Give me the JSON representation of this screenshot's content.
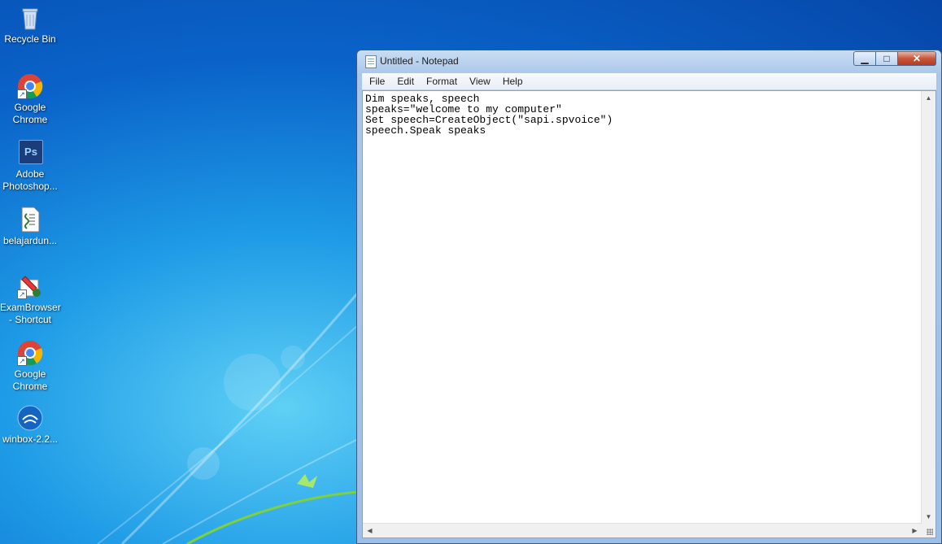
{
  "desktop": {
    "icons": [
      {
        "label": "Recycle Bin",
        "icon": "recycle-bin-icon"
      },
      {
        "label": "Google Chrome",
        "icon": "chrome-icon"
      },
      {
        "label": "Adobe Photoshop...",
        "icon": "photoshop-icon",
        "badge": "Ps"
      },
      {
        "label": "belajardun...",
        "icon": "script-file-icon"
      },
      {
        "label": "ExamBrowser - Shortcut",
        "icon": "exam-browser-icon"
      },
      {
        "label": "Google Chrome",
        "icon": "chrome-icon"
      },
      {
        "label": "winbox-2.2...",
        "icon": "winbox-icon"
      }
    ]
  },
  "window": {
    "title": "Untitled - Notepad",
    "controls": {
      "minimize": "▁",
      "maximize": "□",
      "close": "✕"
    },
    "menu": [
      "File",
      "Edit",
      "Format",
      "View",
      "Help"
    ],
    "content": "Dim speaks, speech\nspeaks=\"welcome to my computer\"\nSet speech=CreateObject(\"sapi.spvoice\")\nspeech.Speak speaks"
  },
  "colors": {
    "desktop_blue": "#0a63c9",
    "titlebar": "#a9c7ea",
    "close_button": "#c8553b"
  }
}
